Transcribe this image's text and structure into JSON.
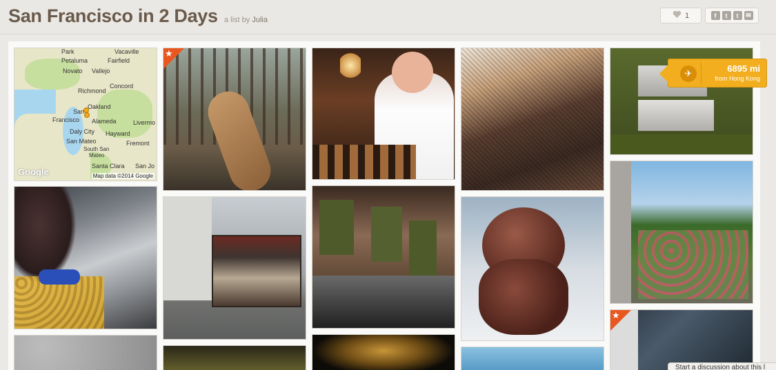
{
  "header": {
    "title": "San Francisco in 2 Days",
    "byline_prefix": "a list by",
    "author": "Julia"
  },
  "like": {
    "count": "1",
    "icon": "heart-icon"
  },
  "share": {
    "facebook": "f",
    "twitter": "t",
    "tumblr": "t",
    "email": "✉"
  },
  "map": {
    "labels": [
      "Park",
      "Vacaville",
      "Petaluma",
      "Fairfield",
      "Novato",
      "Vallejo",
      "Richmond",
      "Concord",
      "Oakland",
      "San",
      "Francisco",
      "Alameda",
      "Livermo",
      "Daly City",
      "Hayward",
      "San Mateo",
      "Fremont",
      "South San",
      "Mateo",
      "Santa Clara",
      "San Jo"
    ],
    "logo": "Google",
    "attribution": "Map data ©2014 Google"
  },
  "distance_badge": {
    "distance": "6895 mi",
    "from": "from Hong Kong"
  },
  "discussion": {
    "label": "Start a discussion about this l"
  },
  "colors": {
    "title": "#6a5a4a",
    "badge_orange": "#e8571f",
    "distance_yellow": "#f2ae1e"
  }
}
